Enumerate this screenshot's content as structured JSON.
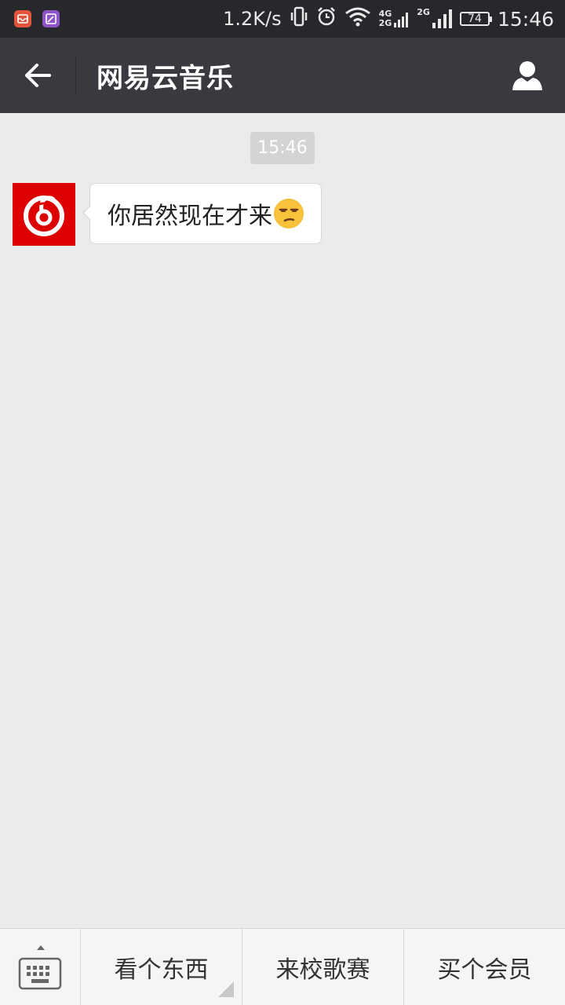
{
  "status_bar": {
    "net_speed": "1.2K/s",
    "net_labels": [
      "4G",
      "2G",
      "2G"
    ],
    "battery": "74",
    "time": "15:46",
    "notification_icons": [
      "mail-app-icon",
      "gallery-app-icon"
    ],
    "status_icons": [
      "vibrate-icon",
      "alarm-icon",
      "wifi-icon",
      "signal-icon",
      "signal-icon"
    ]
  },
  "header": {
    "title": "网易云音乐",
    "back_icon": "back-arrow-icon",
    "profile_icon": "person-icon"
  },
  "chat": {
    "timestamp": "15:46",
    "messages": [
      {
        "sender_icon": "netease-cloud-music-logo",
        "text": "你居然现在才来",
        "emoji": "unamused-face-emoji"
      }
    ]
  },
  "bottom_menu": {
    "keyboard_icon": "keyboard-icon",
    "items": [
      {
        "label": "看个东西",
        "has_submenu": true
      },
      {
        "label": "来校歌赛",
        "has_submenu": false
      },
      {
        "label": "买个会员",
        "has_submenu": false
      }
    ]
  },
  "colors": {
    "status_bar": "#27282c",
    "title_bar": "#393a3f",
    "chat_bg": "#ebebeb",
    "brand_red": "#dd0000",
    "menu_bg": "#f5f5f5"
  }
}
